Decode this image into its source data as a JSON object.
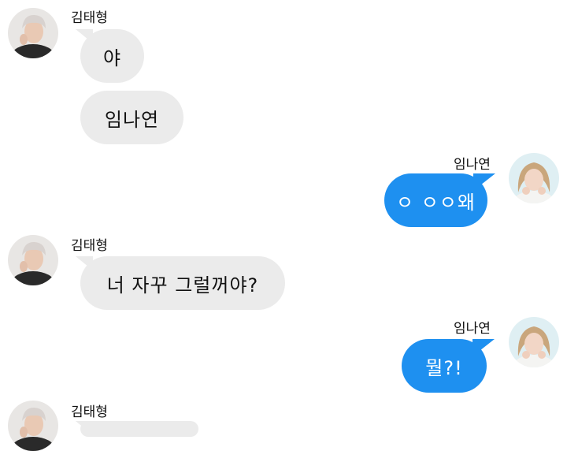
{
  "colors": {
    "sent_bubble": "#1e90f0",
    "received_bubble": "#ebebeb",
    "background": "#ffffff"
  },
  "participants": {
    "left": {
      "name": "김태형",
      "avatar_icon": "male-profile-avatar"
    },
    "right": {
      "name": "임나연",
      "avatar_icon": "female-profile-avatar"
    }
  },
  "messages": [
    {
      "sender": "김태형",
      "text": "야"
    },
    {
      "sender": "김태형",
      "text": "임나연"
    },
    {
      "sender": "임나연",
      "text": "ㅇ ㅇㅇ왜"
    },
    {
      "sender": "김태형",
      "text": "너 자꾸 그럴꺼야?"
    },
    {
      "sender": "임나연",
      "text": "뭘?!"
    },
    {
      "sender": "김태형",
      "text": ""
    }
  ]
}
